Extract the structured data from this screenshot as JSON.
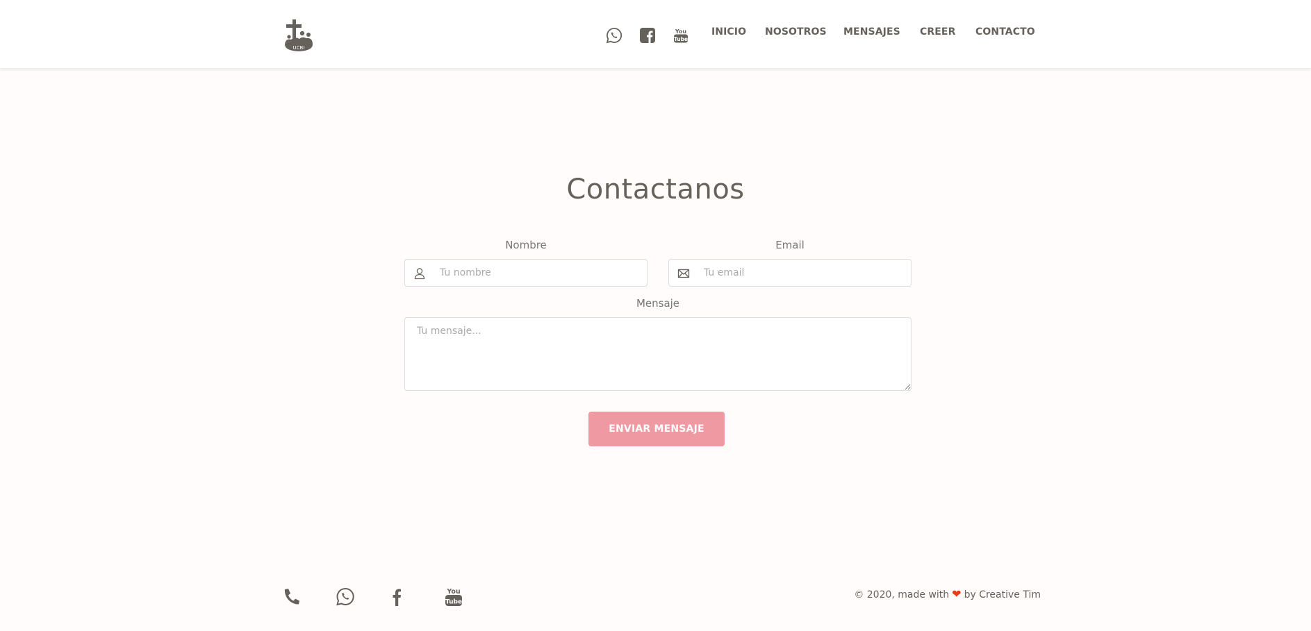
{
  "navbar": {
    "logo_icon": "church-cross-logo-icon",
    "social_icons": [
      "whatsapp-icon",
      "facebook-square-icon",
      "youtube-icon"
    ],
    "links": [
      {
        "label": "INICIO"
      },
      {
        "label": "NOSOTROS"
      },
      {
        "label": "MENSAJES"
      },
      {
        "label": "CREER"
      },
      {
        "label": "CONTACTO"
      }
    ]
  },
  "contact": {
    "title": "Contactanos",
    "name_label": "Nombre",
    "name_placeholder": "Tu nombre",
    "name_icon": "user-icon",
    "email_label": "Email",
    "email_placeholder": "Tu email",
    "email_icon": "envelope-icon",
    "message_label": "Mensaje",
    "message_placeholder": "Tu mensaje...",
    "submit_label": "ENVIAR MENSAJE",
    "submit_color": "#ef9aa3"
  },
  "footer": {
    "icons": [
      "phone-icon",
      "whatsapp-icon",
      "facebook-icon",
      "youtube-icon"
    ],
    "credits_prefix": "© 2020, made with",
    "credits_suffix": "by Creative Tim",
    "heart_color": "#f33816"
  }
}
